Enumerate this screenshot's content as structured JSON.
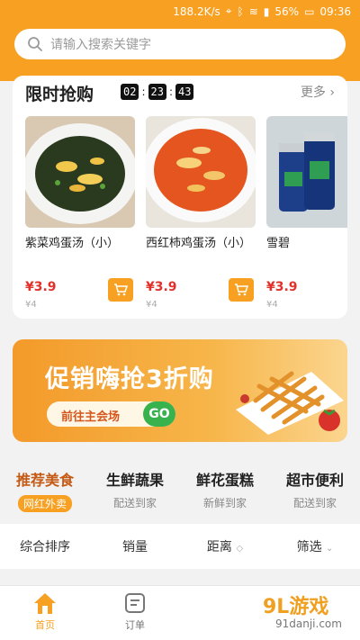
{
  "status": {
    "speed": "188.2K/s",
    "battery": "56%",
    "time": "09:36"
  },
  "search": {
    "placeholder": "请输入搜索关键字"
  },
  "flash_sale": {
    "title": "限时抢购",
    "timer": [
      "02",
      "23",
      "43"
    ],
    "more": "更多",
    "products": [
      {
        "name": "紫菜鸡蛋汤（小）",
        "price": "¥3.9",
        "old_price": "¥4"
      },
      {
        "name": "西红柿鸡蛋汤（小）",
        "price": "¥3.9",
        "old_price": "¥4"
      },
      {
        "name": "雪碧",
        "price": "¥3.9",
        "old_price": "¥4"
      }
    ]
  },
  "banner": {
    "title": "促销嗨抢3折购",
    "button": "前往主会场",
    "go": "GO"
  },
  "categories": [
    {
      "name": "推荐美食",
      "sub": "网红外卖"
    },
    {
      "name": "生鲜蔬果",
      "sub": "配送到家"
    },
    {
      "name": "鲜花蛋糕",
      "sub": "新鲜到家"
    },
    {
      "name": "超市便利",
      "sub": "配送到家"
    }
  ],
  "sort": [
    "综合排序",
    "销量",
    "距离",
    "筛选"
  ],
  "tabs": [
    {
      "label": "首页"
    },
    {
      "label": "订单"
    }
  ],
  "watermark": {
    "main": "9L游戏",
    "site": "91danji.com"
  },
  "colors": {
    "accent": "#f7a021",
    "price": "#e0322b"
  }
}
